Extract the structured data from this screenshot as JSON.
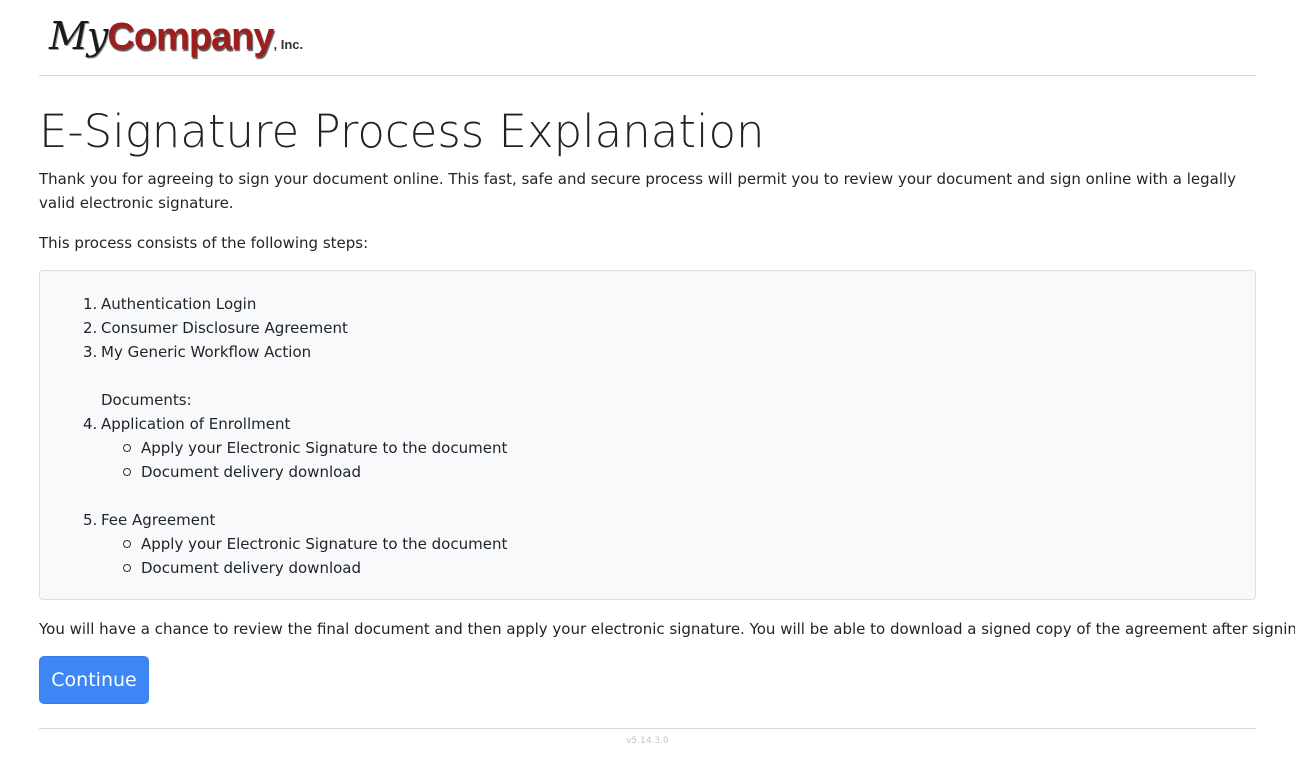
{
  "logo": {
    "my": "My",
    "company": "Company",
    "inc": ", Inc."
  },
  "page": {
    "title": "E-Signature Process Explanation",
    "intro": "Thank you for agreeing to sign your document online. This fast, safe and secure process will permit you to review your document and sign online with a legally valid electronic signature.",
    "steps_intro": "This process consists of the following steps:",
    "steps": [
      {
        "num": "1.",
        "label": "Authentication Login"
      },
      {
        "num": "2.",
        "label": "Consumer Disclosure Agreement"
      },
      {
        "num": "3.",
        "label": "My Generic Workflow Action"
      }
    ],
    "documents_label": "Documents:",
    "documents": [
      {
        "num": "4.",
        "label": "Application of Enrollment",
        "subitems": [
          "Apply your Electronic Signature to the document",
          "Document delivery download"
        ]
      },
      {
        "num": "5.",
        "label": "Fee Agreement",
        "subitems": [
          "Apply your Electronic Signature to the document",
          "Document delivery download"
        ]
      }
    ],
    "closing": "You will have a chance to review the final document and then apply your electronic signature. You will be able to download a signed copy of the agreement after signing.",
    "continue_label": "Continue"
  },
  "footer": {
    "version": "v5.14.3.0"
  },
  "colors": {
    "accent": "#3c86f6",
    "brand_red": "#a01d1d"
  }
}
